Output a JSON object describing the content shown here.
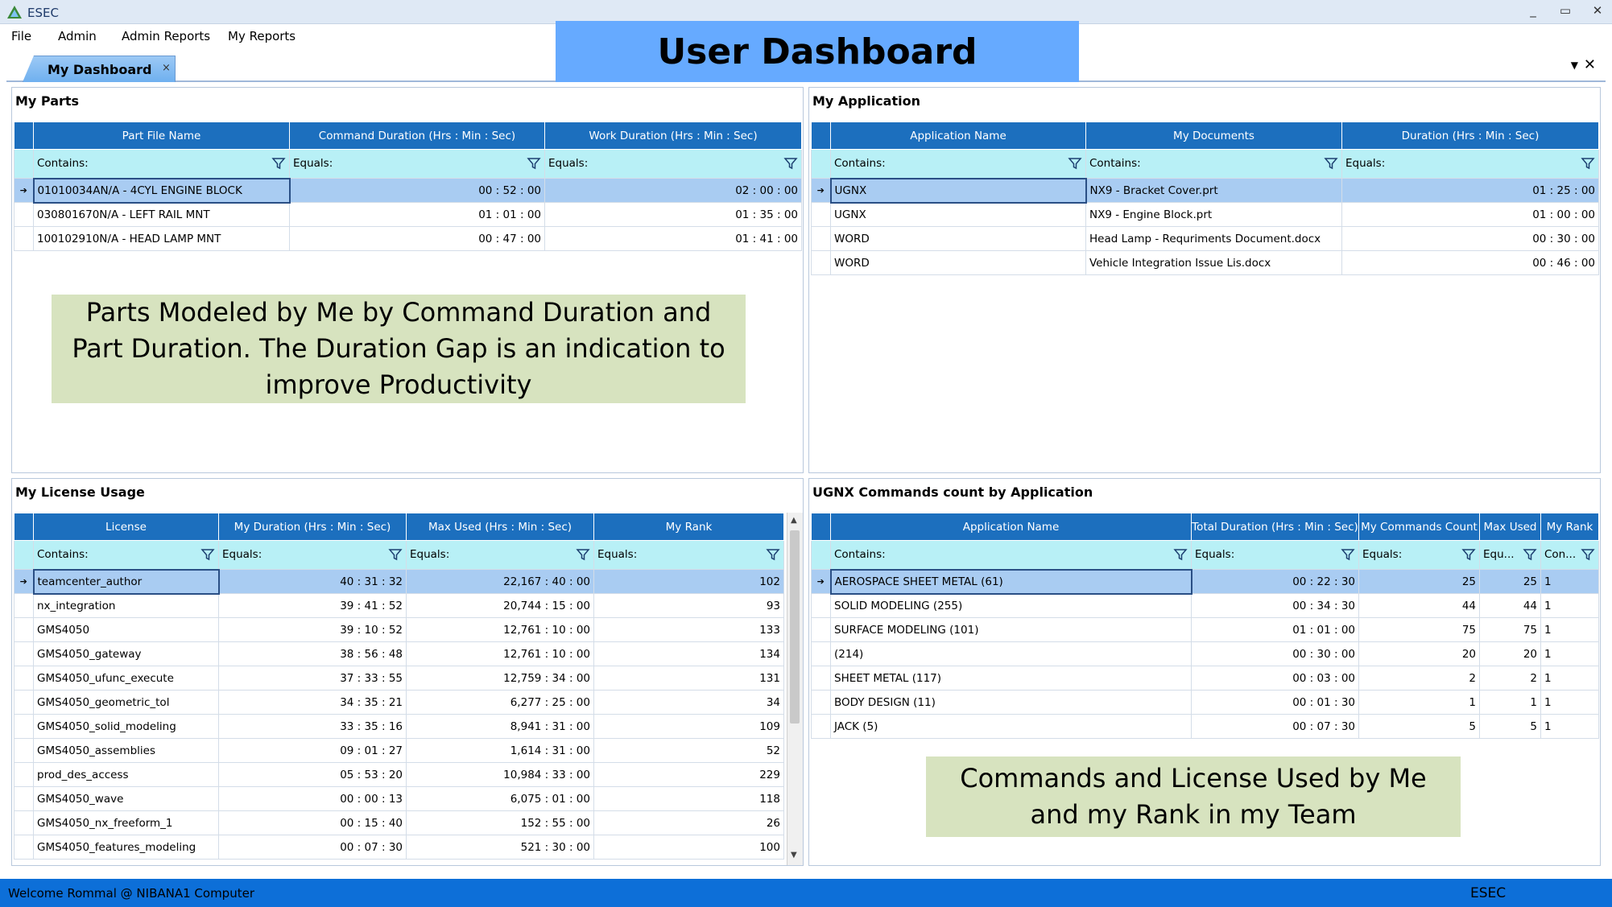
{
  "window": {
    "title": "ESEC",
    "controls": [
      "_",
      "▭",
      "✕"
    ]
  },
  "menu": {
    "items": [
      "File",
      "Admin",
      "Admin Reports",
      "My Reports"
    ]
  },
  "banner": "User Dashboard",
  "tabs": {
    "active": "My Dashboard",
    "close": "×"
  },
  "my_parts": {
    "title": "My Parts",
    "columns": [
      "Part File Name",
      "Command Duration (Hrs : Min : Sec)",
      "Work Duration (Hrs : Min : Sec)"
    ],
    "filters": [
      "Contains:",
      "Equals:",
      "Equals:"
    ],
    "rows": [
      [
        "01010034AN/A - 4CYL ENGINE BLOCK",
        "00 : 52 : 00",
        "02 : 00 : 00"
      ],
      [
        "030801670N/A - LEFT RAIL MNT",
        "01 : 01 : 00",
        "01 : 35 : 00"
      ],
      [
        "100102910N/A - HEAD LAMP MNT",
        "00 : 47 : 00",
        "01 : 41 : 00"
      ]
    ]
  },
  "my_application": {
    "title": "My Application",
    "columns": [
      "Application Name",
      "My Documents",
      "Duration (Hrs : Min : Sec)"
    ],
    "filters": [
      "Contains:",
      "Contains:",
      "Equals:"
    ],
    "rows": [
      [
        "UGNX",
        "NX9 - Bracket Cover.prt",
        "01 : 25 : 00"
      ],
      [
        "UGNX",
        "NX9 - Engine Block.prt",
        "01 : 00 : 00"
      ],
      [
        "WORD",
        "Head Lamp - Requriments Document.docx",
        "00 : 30 : 00"
      ],
      [
        "WORD",
        "Vehicle Integration Issue Lis.docx",
        "00 : 46 : 00"
      ]
    ]
  },
  "my_license_usage": {
    "title": "My License Usage",
    "columns": [
      "License",
      "My Duration (Hrs : Min : Sec)",
      "Max Used (Hrs : Min : Sec)",
      "My Rank"
    ],
    "filters": [
      "Contains:",
      "Equals:",
      "Equals:",
      "Equals:"
    ],
    "rows": [
      [
        "teamcenter_author",
        "40 : 31 : 32",
        "22,167 : 40 : 00",
        "102"
      ],
      [
        "nx_integration",
        "39 : 41 : 52",
        "20,744 : 15 : 00",
        "93"
      ],
      [
        "GMS4050",
        "39 : 10 : 52",
        "12,761 : 10 : 00",
        "133"
      ],
      [
        "GMS4050_gateway",
        "38 : 56 : 48",
        "12,761 : 10 : 00",
        "134"
      ],
      [
        "GMS4050_ufunc_execute",
        "37 : 33 : 55",
        "12,759 : 34 : 00",
        "131"
      ],
      [
        "GMS4050_geometric_tol",
        "34 : 35 : 21",
        "6,277 : 25 : 00",
        "34"
      ],
      [
        "GMS4050_solid_modeling",
        "33 : 35 : 16",
        "8,941 : 31 : 00",
        "109"
      ],
      [
        "GMS4050_assemblies",
        "09 : 01 : 27",
        "1,614 : 31 : 00",
        "52"
      ],
      [
        "prod_des_access",
        "05 : 53 : 20",
        "10,984 : 33 : 00",
        "229"
      ],
      [
        "GMS4050_wave",
        "00 : 00 : 13",
        "6,075 : 01 : 00",
        "118"
      ],
      [
        "GMS4050_nx_freeform_1",
        "00 : 15 : 40",
        "152 : 55 : 00",
        "26"
      ],
      [
        "GMS4050_features_modeling",
        "00 : 07 : 30",
        "521 : 30 : 00",
        "100"
      ]
    ]
  },
  "ugnx_commands": {
    "title": "UGNX Commands count by Application",
    "columns": [
      "Application Name",
      "Total Duration (Hrs : Min : Sec)",
      "My Commands Count",
      "Max Used",
      "My Rank"
    ],
    "filters": [
      "Contains:",
      "Equals:",
      "Equals:",
      "Equ...",
      "Con..."
    ],
    "rows": [
      [
        "AEROSPACE SHEET METAL (61)",
        "00 : 22 : 30",
        "25",
        "25",
        "1"
      ],
      [
        "SOLID MODELING (255)",
        "00 : 34 : 30",
        "44",
        "44",
        "1"
      ],
      [
        "SURFACE MODELING (101)",
        "01 : 01 : 00",
        "75",
        "75",
        "1"
      ],
      [
        " (214)",
        "00 : 30 : 00",
        "20",
        "20",
        "1"
      ],
      [
        "SHEET METAL (117)",
        "00 : 03 : 00",
        "2",
        "2",
        "1"
      ],
      [
        "BODY DESIGN (11)",
        "00 : 01 : 30",
        "1",
        "1",
        "1"
      ],
      [
        "JACK (5)",
        "00 : 07 : 30",
        "5",
        "5",
        "1"
      ]
    ]
  },
  "notes": {
    "parts": "Parts Modeled by Me by Command Duration and Part Duration. The Duration Gap is an indication to improve Productivity",
    "commands": "Commands  and License Used by Me and my Rank in my Team"
  },
  "status": {
    "left": "Welcome Rommal @ NIBANA1 Computer",
    "right": "ESEC"
  },
  "colors": {
    "header": "#1c6fbe",
    "filter_row": "#b8f0f6",
    "selected_row": "#a9ccf2",
    "banner": "#66aaff",
    "note": "#d7e3bf",
    "status": "#0d6fd8"
  }
}
